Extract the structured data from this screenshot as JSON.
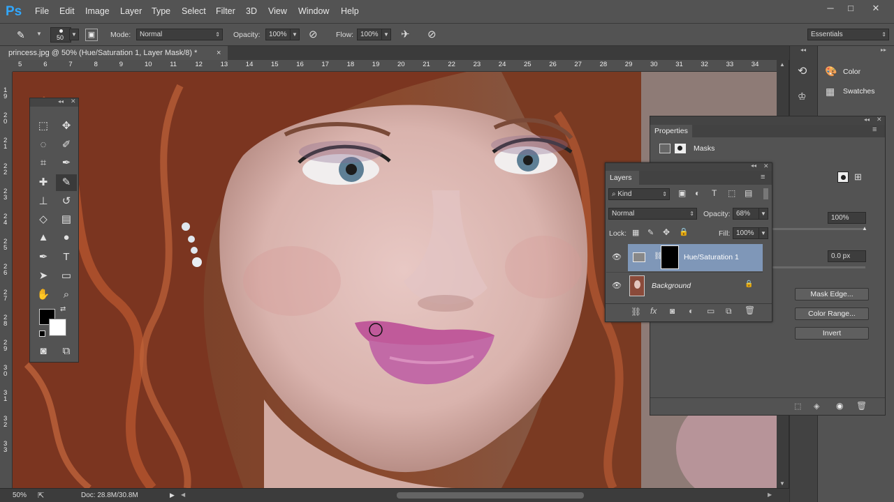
{
  "app": {
    "logo": "Ps"
  },
  "menu": [
    "File",
    "Edit",
    "Image",
    "Layer",
    "Type",
    "Select",
    "Filter",
    "3D",
    "View",
    "Window",
    "Help"
  ],
  "window_controls": {
    "minimize": "─",
    "maximize": "□",
    "close": "✕"
  },
  "options": {
    "brush_size": "50",
    "mode_label": "Mode:",
    "mode_value": "Normal",
    "opacity_label": "Opacity:",
    "opacity_value": "100%",
    "flow_label": "Flow:",
    "flow_value": "100%",
    "workspace": "Essentials"
  },
  "document": {
    "tab_title": "princess.jpg @ 50% (Hue/Saturation 1, Layer Mask/8) *",
    "tab_close": "×",
    "zoom": "50%",
    "doc_info": "Doc: 28.8M/30.8M"
  },
  "ruler_top": [
    "5",
    "6",
    "7",
    "8",
    "9",
    "10",
    "11",
    "12",
    "13",
    "14",
    "15",
    "16",
    "17",
    "18",
    "19",
    "20",
    "21",
    "22",
    "23",
    "24",
    "25",
    "26",
    "27",
    "28",
    "29",
    "30",
    "31",
    "32",
    "33",
    "34"
  ],
  "ruler_left": [
    "19",
    "20",
    "21",
    "22",
    "23",
    "24",
    "25",
    "26",
    "27",
    "28",
    "29",
    "30",
    "31",
    "32",
    "33"
  ],
  "dock": {
    "color_label": "Color",
    "swatches_label": "Swatches"
  },
  "properties": {
    "title": "Properties",
    "mode": "Masks",
    "density": "100%",
    "feather": "0.0 px",
    "mask_edge": "Mask Edge...",
    "color_range": "Color Range...",
    "invert": "Invert"
  },
  "layers": {
    "title": "Layers",
    "filter_kind": "Kind",
    "blend_mode": "Normal",
    "opacity_label": "Opacity:",
    "opacity_value": "68%",
    "lock_label": "Lock:",
    "fill_label": "Fill:",
    "fill_value": "100%",
    "items": [
      {
        "name": "Hue/Saturation 1",
        "selected": true
      },
      {
        "name": "Background",
        "selected": false
      }
    ],
    "footer_fx": "fx"
  },
  "colors": {
    "accent_selection": "#7f97b8",
    "panel_bg": "#535353",
    "ps_blue": "#31a8ff"
  }
}
